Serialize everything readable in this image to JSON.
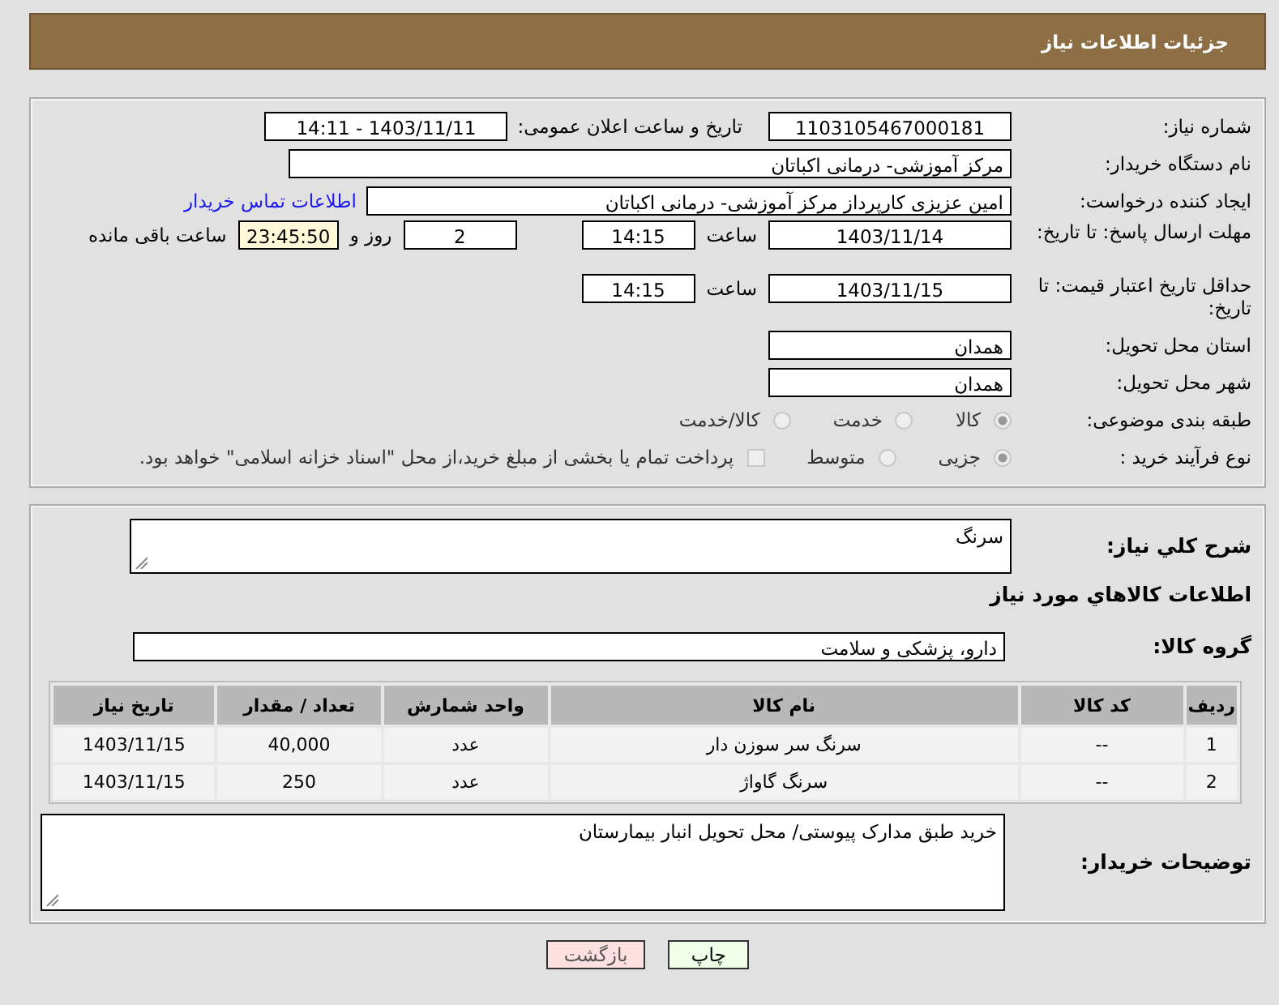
{
  "header": {
    "title": "جزئیات اطلاعات نیاز"
  },
  "need_number": {
    "label": "شماره نیاز:",
    "value": "1103105467000181"
  },
  "announce": {
    "label": "تاریخ و ساعت اعلان عمومی:",
    "value": "1403/11/11 - 14:11"
  },
  "buyer": {
    "label": "نام دستگاه خریدار:",
    "value": "مرکز آموزشی- درمانی اکباتان"
  },
  "creator": {
    "label": "ایجاد کننده درخواست:",
    "value": "امین عزیزی کارپرداز مرکز آموزشی- درمانی اکباتان",
    "link": "اطلاعات تماس خریدار"
  },
  "reply_deadline": {
    "label": "مهلت ارسال پاسخ: تا تاریخ:",
    "date": "1403/11/14",
    "time_label": "ساعت",
    "time": "14:15",
    "days": "2",
    "days_label": "روز و",
    "remaining": "23:45:50",
    "remaining_label": "ساعت باقی مانده"
  },
  "price_validity": {
    "label": "حداقل تاریخ اعتبار قیمت: تا تاریخ:",
    "date": "1403/11/15",
    "time_label": "ساعت",
    "time": "14:15"
  },
  "province": {
    "label": "استان محل تحویل:",
    "value": "همدان"
  },
  "city": {
    "label": "شهر محل تحویل:",
    "value": "همدان"
  },
  "category": {
    "label": "طبقه بندی موضوعی:",
    "options": [
      {
        "label": "کالا",
        "selected": true
      },
      {
        "label": "خدمت",
        "selected": false
      },
      {
        "label": "کالا/خدمت",
        "selected": false
      }
    ]
  },
  "process": {
    "label": "نوع فرآیند خرید :",
    "options": [
      {
        "label": "جزیی",
        "selected": true
      },
      {
        "label": "متوسط",
        "selected": false
      }
    ],
    "treasury": {
      "label": "پرداخت تمام یا بخشی از مبلغ خرید،از محل \"اسناد خزانه اسلامی\" خواهد بود.",
      "checked": false
    }
  },
  "summary": {
    "label": "شرح کلي نياز:",
    "value": "سرنگ"
  },
  "goods_title": "اطلاعات کالاهاي مورد نياز",
  "goods_group": {
    "label": "گروه کالا:",
    "value": "دارو، پزشکی و سلامت"
  },
  "table": {
    "columns": [
      "ردیف",
      "کد کالا",
      "نام کالا",
      "واحد شمارش",
      "تعداد / مقدار",
      "تاریخ نیاز"
    ],
    "rows": [
      [
        "1",
        "--",
        "سرنگ سر سوزن دار",
        "عدد",
        "40,000",
        "1403/11/15"
      ],
      [
        "2",
        "--",
        "سرنگ گاواژ",
        "عدد",
        "250",
        "1403/11/15"
      ]
    ]
  },
  "buyer_notes": {
    "label": "توضیحات خریدار:",
    "value": "خرید طبق مدارک پیوستی/ محل تحویل انبار بیمارستان"
  },
  "buttons": [
    {
      "label": "چاپ",
      "kind": "print"
    },
    {
      "label": "بازگشت",
      "kind": "back"
    }
  ]
}
